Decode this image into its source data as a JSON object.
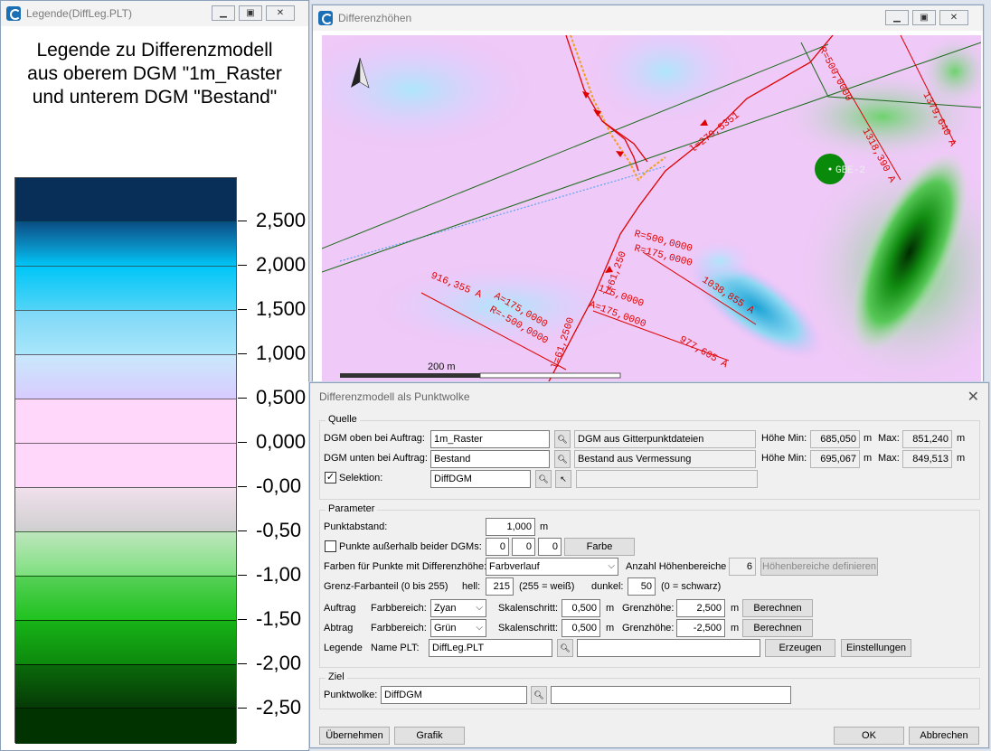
{
  "legend_window": {
    "title": "Legende(DiffLeg.PLT)",
    "heading_lines": [
      "Legende zu Differenzmodell",
      "aus oberem DGM \"1m_Raster",
      "und unterem DGM \"Bestand\""
    ],
    "labels": [
      "2,500",
      "2,000",
      "1,500",
      "1,000",
      "0,500",
      "0,000",
      "-0,00",
      "-0,50",
      "-1,00",
      "-1,50",
      "-2,00",
      "-2,50"
    ],
    "colors": {
      "dark_blue": "#082f57",
      "cyan": "#00c6f7",
      "light_cyan": "#a9e6fb",
      "lavender": "#d8ccff",
      "pink": "#ffd7fb",
      "light_green": "#7ee07e",
      "green": "#1fc21f",
      "dark_green": "#003300"
    }
  },
  "map_window": {
    "title": "Differenzhöhen",
    "scale_label": "200 m",
    "marker_label": "GBE-2",
    "annotations": [
      "l=279,5351",
      "1318,390 A",
      "1379,640 A",
      "R=500,0000",
      "R=175,0000",
      "1038,855 A",
      "916,355 A",
      "A=175,0000",
      "R=-500,0000",
      "l=61,2500",
      "l=61,250",
      "A=175,0000",
      "977,605 A",
      "175,0000"
    ]
  },
  "dialog": {
    "title": "Differenzmodell als Punktwolke",
    "quelle": {
      "label": "Quelle",
      "dgm_oben_label": "DGM oben bei Auftrag:",
      "dgm_oben_value": "1m_Raster",
      "dgm_oben_desc": "DGM aus Gitterpunktdateien",
      "dgm_unten_label": "DGM unten bei Auftrag:",
      "dgm_unten_value": "Bestand",
      "dgm_unten_desc": "Bestand aus Vermessung",
      "hoehe_min_label": "Höhe Min:",
      "max_label": "Max:",
      "unit_m": "m",
      "oben_min": "685,050",
      "oben_max": "851,240",
      "unten_min": "695,067",
      "unten_max": "849,513",
      "selektion_label": "Selektion:",
      "selektion_checked": true,
      "selektion_value": "DiffDGM",
      "selektion_extra": ""
    },
    "parameter": {
      "label": "Parameter",
      "punktabstand_label": "Punktabstand:",
      "punktabstand_value": "1,000",
      "unit_m": "m",
      "ausserhalb_label": "Punkte außerhalb beider DGMs:",
      "ausserhalb_checked": false,
      "rgb": [
        "0",
        "0",
        "0"
      ],
      "farbe_button": "Farbe",
      "farben_label": "Farben für Punkte mit Differenzhöhe:",
      "farben_value": "Farbverlauf",
      "anzahl_label": "Anzahl Höhenbereiche",
      "anzahl_value": "6",
      "definieren_button": "Höhenbereiche definieren",
      "grenz_label": "Grenz-Farbanteil (0 bis 255)",
      "hell_label": "hell:",
      "hell_value": "215",
      "hell_hint": "(255 = weiß)",
      "dunkel_label": "dunkel:",
      "dunkel_value": "50",
      "dunkel_hint": "(0 = schwarz)",
      "farbbereich_label": "Farbbereich:",
      "skalenschritt_label": "Skalenschritt:",
      "grenzhoehe_label": "Grenzhöhe:",
      "berechnen_button": "Berechnen",
      "auftrag_label": "Auftrag",
      "auftrag_farbe": "Zyan",
      "auftrag_schritt": "0,500",
      "auftrag_grenz": "2,500",
      "abtrag_label": "Abtrag",
      "abtrag_farbe": "Grün",
      "abtrag_schritt": "0,500",
      "abtrag_grenz": "-2,500",
      "legende_label": "Legende",
      "name_plt_label": "Name PLT:",
      "name_plt_value": "DiffLeg.PLT",
      "legende_extra": "",
      "erzeugen_button": "Erzeugen",
      "einstellungen_button": "Einstellungen"
    },
    "ziel": {
      "label": "Ziel",
      "punktwolke_label": "Punktwolke:",
      "punktwolke_value": "DiffDGM",
      "punktwolke_extra": ""
    },
    "buttons": {
      "uebernehmen": "Übernehmen",
      "grafik": "Grafik",
      "ok": "OK",
      "abbrechen": "Abbrechen"
    }
  }
}
